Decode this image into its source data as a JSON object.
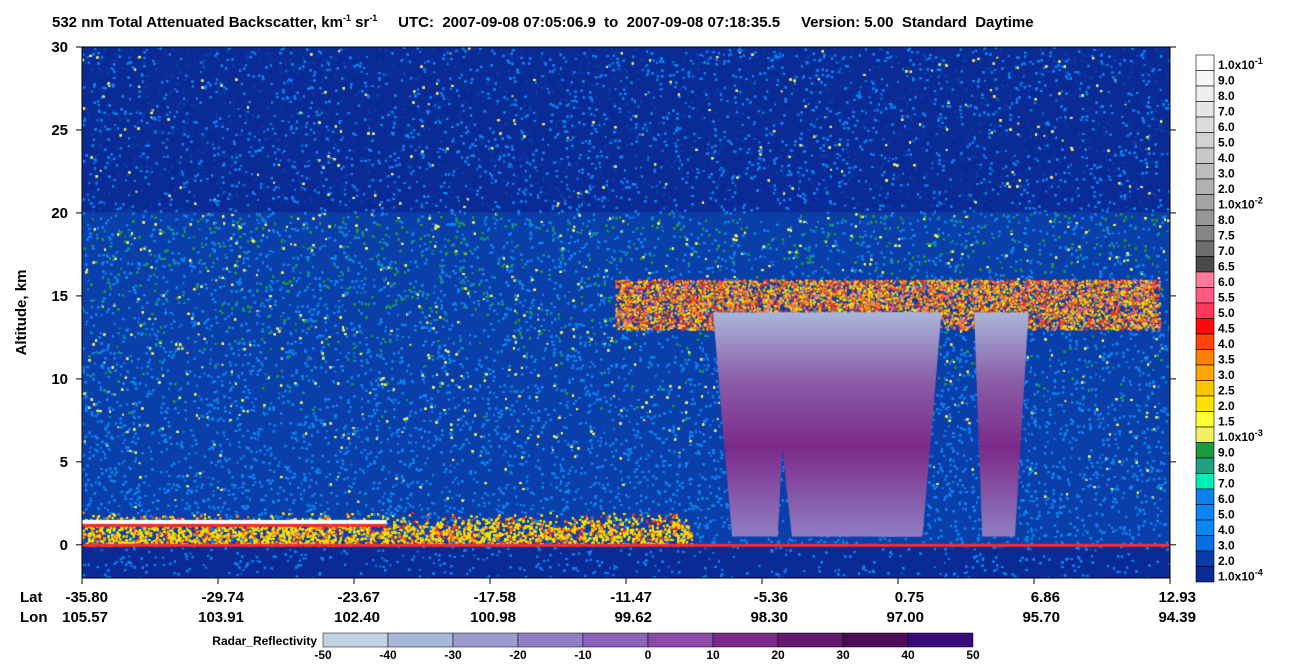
{
  "title": {
    "prefix": "532 nm Total Attenuated Backscatter, km",
    "sup1": "-1",
    "mid": " sr",
    "sup2": "-1",
    "utc_label": "UTC:",
    "utc_start": "2007-09-08 07:05:06.9",
    "to": "to",
    "utc_end": "2007-09-08 07:18:35.5",
    "version": "Version: 5.00",
    "product": "Standard",
    "daytime": "Daytime"
  },
  "chart_data": {
    "type": "heatmap",
    "ylabel": "Altitude, km",
    "ylim": [
      -2,
      30
    ],
    "yticks": [
      0,
      5,
      10,
      15,
      20,
      25,
      30
    ],
    "x_row_labels": [
      "Lat",
      "Lon"
    ],
    "lat_ticks": [
      "-35.80",
      "-29.74",
      "-23.67",
      "-17.58",
      "-11.47",
      "-5.36",
      "0.75",
      "6.86",
      "12.93"
    ],
    "lon_ticks": [
      "105.57",
      "103.91",
      "102.40",
      "100.98",
      "99.62",
      "98.30",
      "97.00",
      "95.70",
      "94.39"
    ],
    "backscatter_colorbar": {
      "labels": [
        "1.0x10-1",
        "9.0",
        "8.0",
        "7.0",
        "6.0",
        "5.0",
        "4.0",
        "3.0",
        "2.0",
        "1.0x10-2",
        "8.0",
        "7.5",
        "7.0",
        "6.5",
        "6.0",
        "5.5",
        "5.0",
        "4.5",
        "4.0",
        "3.5",
        "3.0",
        "2.5",
        "2.0",
        "1.5",
        "1.0x10-3",
        "9.0",
        "8.0",
        "7.0",
        "6.0",
        "5.0",
        "4.0",
        "3.0",
        "2.0",
        "1.0x10-4"
      ],
      "colors": [
        "#ffffff",
        "#f7f7f7",
        "#efefef",
        "#e6e6e6",
        "#dcdcdc",
        "#d2d2d2",
        "#c8c8c8",
        "#bdbdbd",
        "#b1b1b1",
        "#a4a4a4",
        "#969696",
        "#858585",
        "#6e6e6e",
        "#4a4a4a",
        "#ff7a9a",
        "#ff5a80",
        "#ff3a5a",
        "#ff0a0a",
        "#ff4500",
        "#ff7f00",
        "#ffa500",
        "#ffc400",
        "#ffe000",
        "#ffff33",
        "#f0f060",
        "#1e9a3c",
        "#1fa080",
        "#00f0b4",
        "#0a7ff0",
        "#0a84f5",
        "#0a86f5",
        "#0a6ee0",
        "#083aa8",
        "#0a2a96"
      ]
    },
    "reflectivity_colorbar": {
      "label": "Radar_Reflectivity",
      "ticks": [
        "-50",
        "-40",
        "-30",
        "-20",
        "-10",
        "0",
        "10",
        "20",
        "30",
        "40",
        "50"
      ],
      "colors": [
        "#c4d2e6",
        "#a9b7db",
        "#9b9bd0",
        "#8f7fc4",
        "#8b63b8",
        "#8a4ba8",
        "#7c2a8a",
        "#66186f",
        "#4e0b5a",
        "#3a0a7a"
      ]
    },
    "features": {
      "cirrus_band_km": [
        13,
        16
      ],
      "deep_convection_km": [
        0,
        14
      ],
      "boundary_layer_km": [
        0,
        2
      ],
      "surface_km": 0
    }
  },
  "colors": {
    "background_noise": "#0a3ea8",
    "stratosphere": "#0a2a96",
    "midrange": "#0a84f5",
    "yellow_noise": "#f0f060",
    "cloud_red": "#ff2a2a",
    "radar_purple": "#8a5fa8"
  }
}
